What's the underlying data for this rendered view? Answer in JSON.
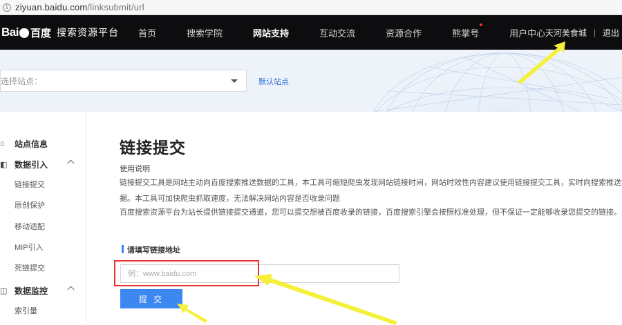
{
  "browser": {
    "url_host": "ziyuan.baidu.com",
    "url_path": "/linksubmit/url"
  },
  "header": {
    "logo_text": "Bai",
    "logo_text2": "百度",
    "platform": "搜索资源平台",
    "nav": [
      {
        "label": "首页"
      },
      {
        "label": "搜索学院"
      },
      {
        "label": "网站支持",
        "active": true
      },
      {
        "label": "互动交流"
      },
      {
        "label": "资源合作"
      },
      {
        "label": "熊掌号",
        "badge": true
      },
      {
        "label": "用户中心"
      }
    ],
    "username": "天河美食城",
    "separator": "|",
    "logout": "退出"
  },
  "banner": {
    "site_select_placeholder": "选择站点：",
    "default_site": "默认站点"
  },
  "sidebar": {
    "site_info": "站点信息",
    "data_import": "数据引入",
    "data_import_items": [
      "链接提交",
      "原创保护",
      "移动适配",
      "MIP引入",
      "死链提交"
    ],
    "data_monitor": "数据监控",
    "data_monitor_items": [
      "索引量"
    ]
  },
  "main": {
    "title": "链接提交",
    "usage_heading": "使用说明",
    "paragraph1": "链接提交工具是网站主动向百度搜索推送数据的工具，本工具可缩短爬虫发现网站链接时间，网站时效性内容建议使用链接提交工具，实时向搜索推送数",
    "paragraph1b": "据。本工具可加快爬虫抓取速度，无法解决网站内容是否收录问题",
    "paragraph2": "百度搜索资源平台为站长提供链接提交通道，您可以提交想被百度收录的链接，百度搜索引擎会按照标准处理，但不保证一定能够收录您提交的链接。",
    "field_label": "请填写链接地址",
    "input_placeholder": "例：www.baidu.com",
    "submit_label": "提 交"
  },
  "colors": {
    "nav_bg": "#0d0d0f",
    "accent": "#3d87f1",
    "annotation_arrow": "#f5f03a",
    "annotation_box": "#e8332e"
  }
}
